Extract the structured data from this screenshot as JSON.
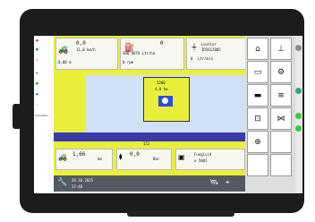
{
  "left_panel": {
    "items": [
      "",
      "",
      "",
      "",
      "",
      "",
      "",
      "Simulation",
      "",
      "",
      ""
    ]
  },
  "top_left": {
    "speed_value": "0,0",
    "speed_unit_small": "11,0 km/h",
    "area_value": "0,00 m"
  },
  "top_center": {
    "rate_value": "0",
    "rate_unit_small": "300 AUTO Ltr/ha",
    "rpm_value": "0 rpm"
  },
  "top_right": {
    "mode_label": "Lochler",
    "mode_sub": "ID5612005",
    "flow_value": "0",
    "flow_unit": "Ltr/min"
  },
  "tank": {
    "volume": "1200",
    "level": "4,0 ha"
  },
  "boom": {
    "count": "152"
  },
  "bottom_left": {
    "value": "1,66",
    "unit": "km"
  },
  "bottom_center": {
    "value": "0,0",
    "unit": "Bar"
  },
  "bottom_right": {
    "label": "Fungicid",
    "code": "e 5001"
  },
  "status": {
    "date": "26.10.2025",
    "time": "17:40"
  },
  "colors": {
    "accent_yellow": "#e9ee3a",
    "blue": "#3a3aaa",
    "dark": "#1b1c1e"
  }
}
